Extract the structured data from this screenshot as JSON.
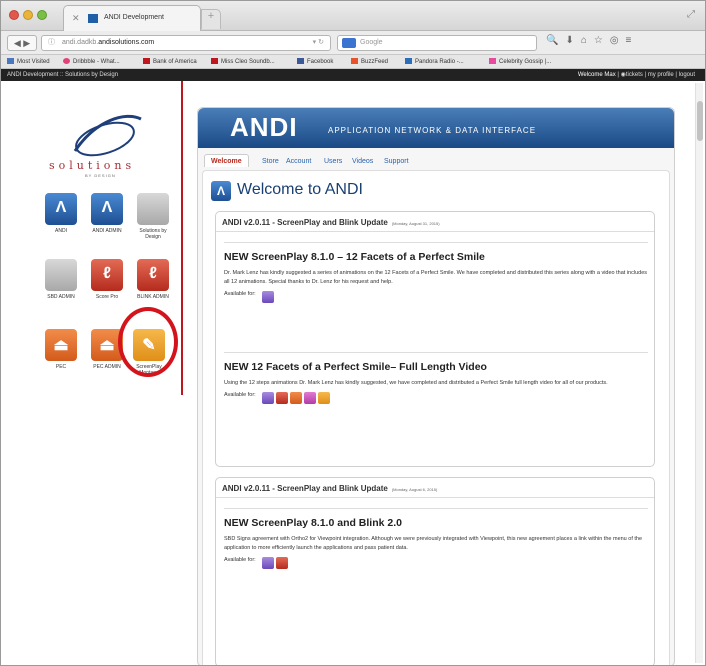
{
  "browser": {
    "tab_title": "ANDI Development",
    "url_prefix": "andi.dadkb.",
    "url_domain": "andisolutions.com",
    "search_placeholder": "Google"
  },
  "bookmarks": [
    "Most Visited",
    "Dribbble - What...",
    "Bank of America",
    "Miss Cleo Soundb...",
    "Facebook",
    "BuzzFeed",
    "Pandora Radio -...",
    "Celebrity Gossip |..."
  ],
  "sitebar": {
    "left": "ANDI Development :: Solutions by Design",
    "welcome": "Welcome Max",
    "links": "| ◉tickets | my profile | logout"
  },
  "sidebar": {
    "logo_text": "solutions",
    "logo_sub": "BY DESIGN",
    "apps": [
      {
        "label": "ANDI",
        "color": "blue",
        "glyph": "Λ"
      },
      {
        "label": "ANDI ADMIN",
        "color": "blue",
        "glyph": "Λ"
      },
      {
        "label": "Solutions by Design",
        "color": "grey",
        "glyph": ""
      },
      {
        "label": "SBD ADMIN",
        "color": "grey",
        "glyph": ""
      },
      {
        "label": "Score Pro",
        "color": "red",
        "glyph": "ℓ"
      },
      {
        "label": "BLINK ADMIN",
        "color": "red",
        "glyph": "ℓ"
      },
      {
        "label": "PEC",
        "color": "orange",
        "glyph": "⏏"
      },
      {
        "label": "PEC ADMIN",
        "color": "orange",
        "glyph": "⏏"
      },
      {
        "label": "ScreenPlay Montage",
        "color": "gold",
        "glyph": "✎"
      }
    ]
  },
  "banner": {
    "title": "ANDI",
    "subtitle": "APPLICATION NETWORK & DATA INTERFACE"
  },
  "tabs": [
    "Welcome",
    "Store",
    "Account",
    "Users",
    "Videos",
    "Support"
  ],
  "welcome_heading": "Welcome to ANDI",
  "cards": [
    {
      "header": "ANDI v2.0.11 - ScreenPlay and Blink Update",
      "date": "(Monday, August 31, 2015)",
      "sections": [
        {
          "title": "NEW ScreenPlay 8.1.0 – 12 Facets of a Perfect Smile",
          "body": "Dr. Mark Lenz has kindly suggested a series of animations on the 12 Facets of a Perfect Smile. We have completed and distributed this series along with a video that includes all 12 animations. Special thanks to Dr. Lenz for his request and help.",
          "available": "Available for:",
          "apps": [
            "purple"
          ]
        },
        {
          "title": "NEW 12 Facets of a Perfect Smile– Full Length Video",
          "body": "Using the 12 steps animations Dr. Mark Lenz has kindly suggested, we have completed and distributed a Perfect Smile full length video for all of our products.",
          "available": "Available for:",
          "apps": [
            "purple",
            "red",
            "orange",
            "pink",
            "gold"
          ]
        }
      ]
    },
    {
      "header": "ANDI v2.0.11 - ScreenPlay and Blink Update",
      "date": "(Monday, August 6, 2015)",
      "sections": [
        {
          "title": "NEW ScreenPlay 8.1.0 and Blink 2.0",
          "body": "SBD Signs agreement with Ortho2 for Viewpoint integration. Although we were previously integrated with Viewpoint, this new agreement places a link within the menu of the application to more efficiently launch the applications and pass patient data.",
          "available": "Available for:",
          "apps": [
            "purple",
            "red"
          ]
        }
      ]
    }
  ]
}
